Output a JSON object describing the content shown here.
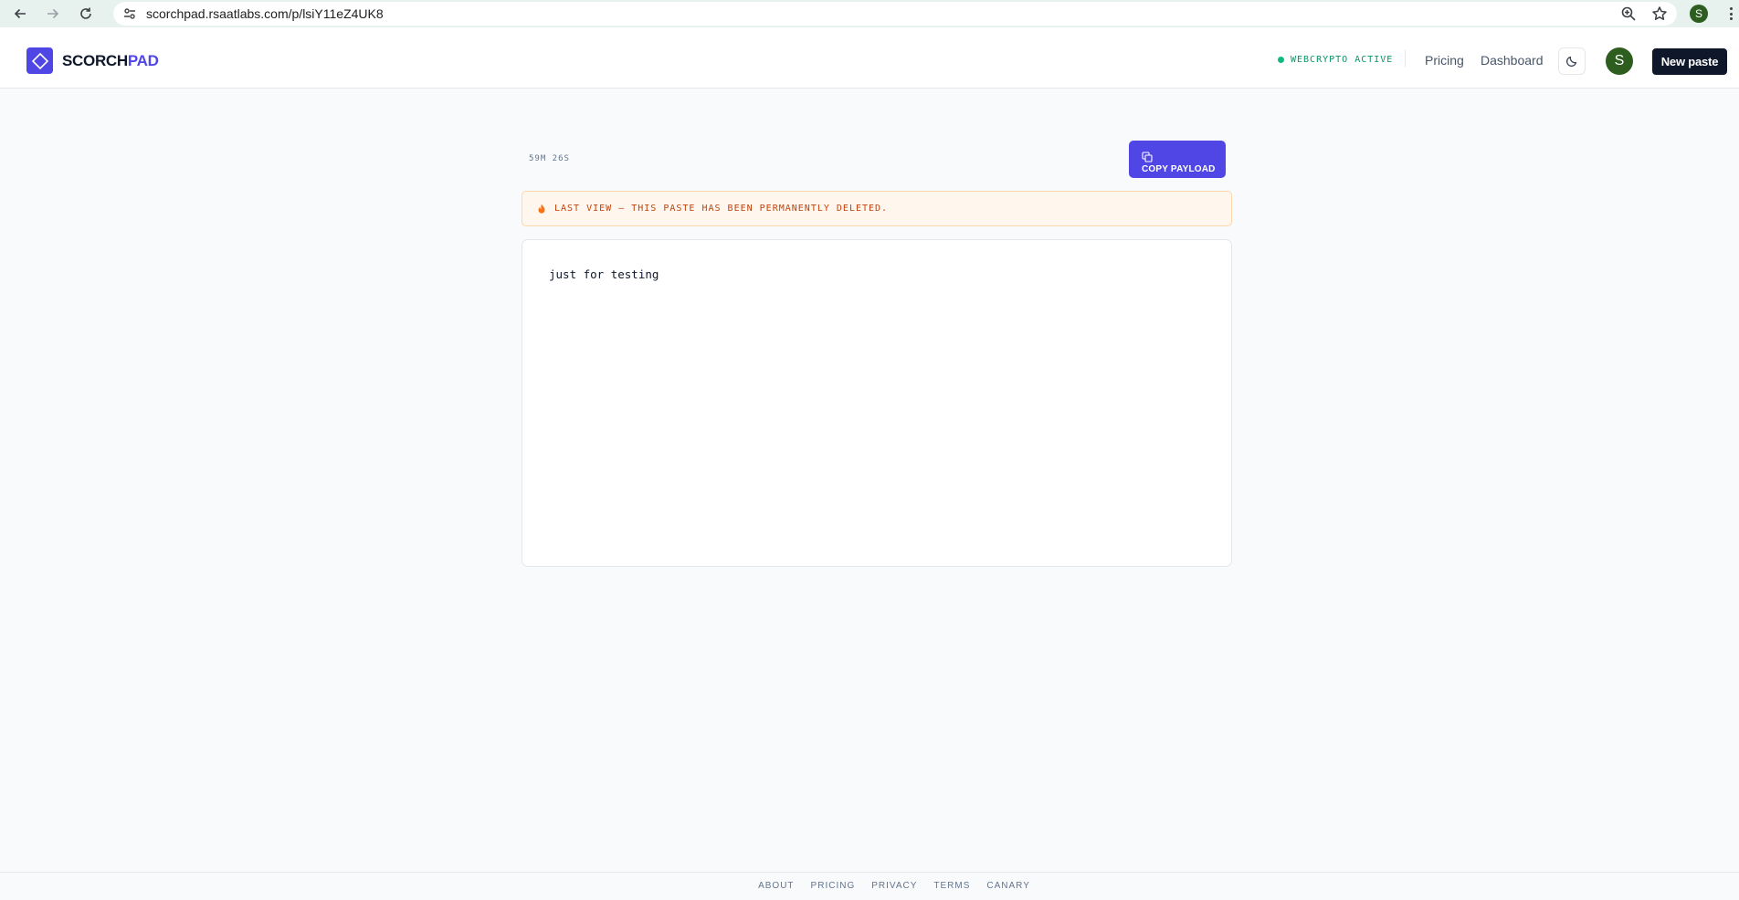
{
  "browser": {
    "url": "scorchpad.rsaatlabs.com/p/lsiY11eZ4UK8",
    "profile_initial": "S"
  },
  "header": {
    "brand_part1": "SCORCH",
    "brand_part2": "PAD",
    "status_text": "WEBCRYPTO ACTIVE",
    "nav_pricing": "Pricing",
    "nav_dashboard": "Dashboard",
    "user_initial": "S",
    "new_paste_label": "New paste"
  },
  "paste": {
    "timer": "59M 26S",
    "copy_label": "COPY PAYLOAD",
    "alert_text": "LAST VIEW — THIS PASTE HAS BEEN PERMANENTLY DELETED.",
    "content": "just for testing"
  },
  "footer": {
    "links": [
      "ABOUT",
      "PRICING",
      "PRIVACY",
      "TERMS",
      "CANARY"
    ]
  },
  "colors": {
    "brand": "#4f46e5",
    "status_green": "#10b981",
    "alert_orange": "#c2410c",
    "dark_button": "#0f172a"
  }
}
